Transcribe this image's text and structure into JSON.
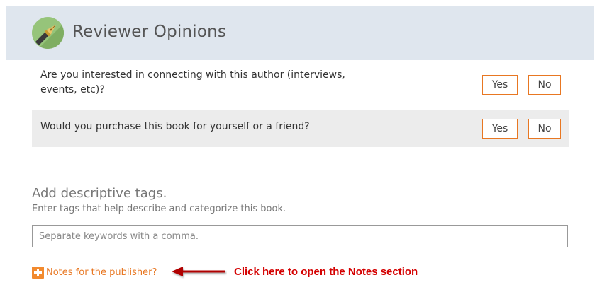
{
  "header": {
    "title": "Reviewer Opinions",
    "icon": "pen-nib-icon"
  },
  "questions": [
    {
      "text": "Are you interested in connecting with this author (interviews, events, etc)?",
      "yes_label": "Yes",
      "no_label": "No"
    },
    {
      "text": "Would you purchase this book for yourself or a friend?",
      "yes_label": "Yes",
      "no_label": "No"
    }
  ],
  "tags": {
    "title": "Add descriptive tags.",
    "subtitle": "Enter tags that help describe and categorize this book.",
    "placeholder": "Separate keywords with a comma.",
    "value": ""
  },
  "notes": {
    "label": "Notes for the publisher?",
    "icon": "plus-icon"
  },
  "annotation": {
    "text": "Click here to open the Notes section",
    "arrow_icon": "left-arrow-icon",
    "color": "#d40000"
  },
  "colors": {
    "accent": "#e87722",
    "header_bg": "#dfe6ee",
    "icon_bg": "#96c47a"
  }
}
